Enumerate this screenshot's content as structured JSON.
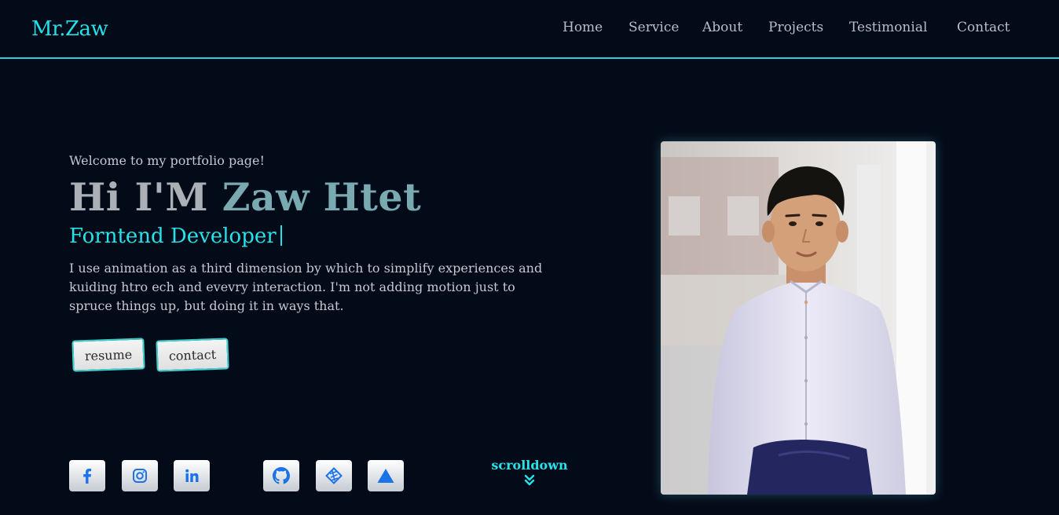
{
  "header": {
    "logo": "Mr.Zaw",
    "nav": [
      "Home",
      "Service",
      "About",
      "Projects",
      "Testimonial",
      "Contact"
    ]
  },
  "hero": {
    "welcome": "Welcome to my portfolio page!",
    "greeting": "Hi I'M",
    "name": "Zaw Htet",
    "role": "Forntend Developer",
    "bio": "I use animation as a third dimension by which to simplify experiences and kuiding htro ech and evevry interaction. I'm not adding motion just to spruce things up, but doing it in ways that.",
    "buttons": {
      "resume": "resume",
      "contact": "contact"
    }
  },
  "social_icons": [
    "facebook-icon",
    "instagram-icon",
    "linkedin-icon",
    "github-icon",
    "netlify-icon",
    "vercel-icon"
  ],
  "scroll": {
    "label": "scrolldown",
    "icon": "double-chevron-down-icon"
  },
  "colors": {
    "background": "#040b18",
    "accent": "#25e3ea",
    "greeting": "#aab0b6",
    "name": "#79a9b1",
    "text": "#c3c9d1",
    "social_icon_blue": "#1a73e8"
  }
}
